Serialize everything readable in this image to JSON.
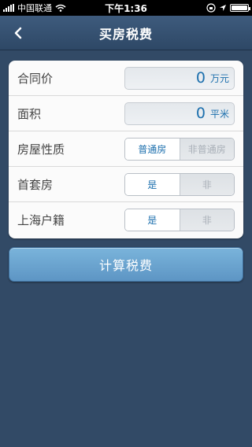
{
  "status_bar": {
    "carrier": "中国联通",
    "time": "下午1:36"
  },
  "nav": {
    "title": "买房税费",
    "back_icon": "chevron-left-icon"
  },
  "form": {
    "rows": [
      {
        "label": "合同价",
        "value": "0",
        "unit": "万元"
      },
      {
        "label": "面积",
        "value": "0",
        "unit": "平米"
      },
      {
        "label": "房屋性质",
        "options": [
          "普通房",
          "非普通房"
        ],
        "selected": "普通房"
      },
      {
        "label": "首套房",
        "options": [
          "是",
          "非"
        ],
        "selected": "是"
      },
      {
        "label": "上海户籍",
        "options": [
          "是",
          "非"
        ],
        "selected": "是"
      }
    ]
  },
  "calc_button": {
    "label": "计算税费"
  },
  "colors": {
    "background": "#324a66",
    "accent": "#1c6fad",
    "button": "#6aa5d1"
  }
}
